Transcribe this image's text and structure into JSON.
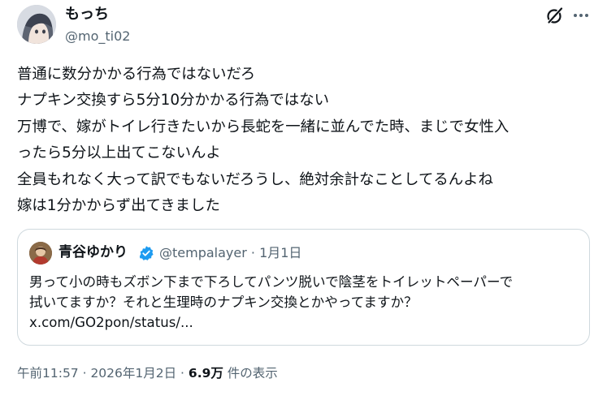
{
  "author": {
    "display_name": "もっち",
    "handle": "@mo_ti02",
    "avatar_icon": "anime-character-avatar"
  },
  "header_actions": {
    "grok_icon": "grok-icon",
    "more_icon": "more-dots-icon"
  },
  "tweet": {
    "lines": [
      "普通に数分かかる行為ではないだろ",
      "ナプキン交換すら5分10分かかる行為ではない",
      "万博で、嫁がトイレ行きたいから長蛇を一緒に並んでた時、まじで女性入",
      "ったら5分以上出てこないんよ",
      "全員もれなく大って訳でもないだろうし、絶対余計なことしてるんよね",
      "嫁は1分かからず出てきました"
    ]
  },
  "quote": {
    "display_name": "青谷ゆかり",
    "verified": true,
    "handle_date": "@tempalayer · 1月1日",
    "lines": [
      "男って小の時もズボン下まで下ろしてパンツ脱いで陰茎をトイレットペーパーで",
      "拭いてますか？それと生理時のナプキン交換とかやってますか？"
    ],
    "link": "x.com/GO2pon/status/..."
  },
  "meta": {
    "timestamp": "午前11:57 · 2026年1月2日 · ",
    "views_count": "6.9万",
    "views_label": " 件の表示"
  },
  "colors": {
    "text": "#0f1419",
    "secondary": "#536471",
    "border": "#cfd9de",
    "verified": "#1d9bf0"
  }
}
